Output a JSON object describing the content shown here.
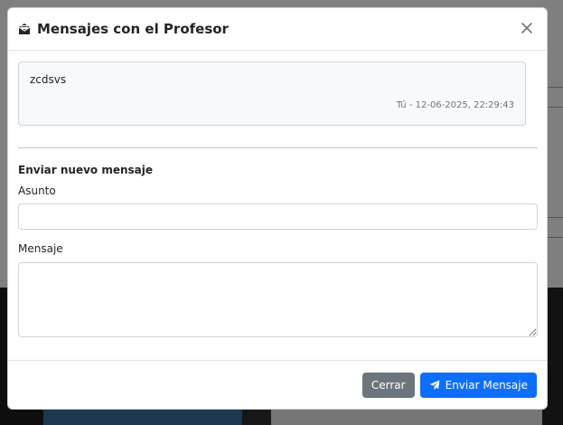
{
  "modal": {
    "title": "Mensajes con el Profesor",
    "title_icon": "envelope-open-icon",
    "close_icon": "close-icon"
  },
  "messages": [
    {
      "text": "zcdsvs",
      "meta": "Tú - 12-06-2025, 22:29:43"
    }
  ],
  "form": {
    "section_title": "Enviar nuevo mensaje",
    "subject_label": "Asunto",
    "subject_value": "",
    "message_label": "Mensaje",
    "message_value": ""
  },
  "footer": {
    "close_label": "Cerrar",
    "send_label": "Enviar Mensaje",
    "send_icon": "paper-plane-icon"
  },
  "colors": {
    "primary": "#0d6efd",
    "secondary": "#6c757d",
    "backdrop": "rgba(0,0,0,0.5)"
  }
}
